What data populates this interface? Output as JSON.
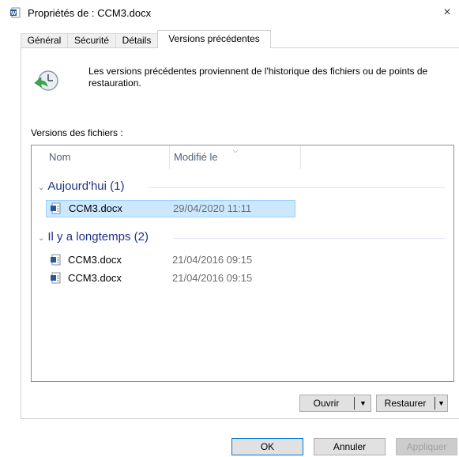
{
  "window": {
    "title": "Propriétés de : CCM3.docx",
    "close_glyph": "×"
  },
  "tabs": [
    {
      "label": "Général"
    },
    {
      "label": "Sécurité"
    },
    {
      "label": "Détails"
    },
    {
      "label": "Versions précédentes",
      "active": true
    }
  ],
  "info": {
    "icon": "restore-clock-icon",
    "text": "Les versions précédentes proviennent de l'historique des fichiers ou de points de restauration."
  },
  "versions_label": "Versions des fichiers :",
  "list": {
    "columns": [
      "Nom",
      "Modifié le"
    ],
    "groups": [
      {
        "label": "Aujourd'hui (1)",
        "rows": [
          {
            "name": "CCM3.docx",
            "modified": "29/04/2020 11:11",
            "selected": true
          }
        ]
      },
      {
        "label": "Il y a longtemps (2)",
        "rows": [
          {
            "name": "CCM3.docx",
            "modified": "21/04/2016 09:15"
          },
          {
            "name": "CCM3.docx",
            "modified": "21/04/2016 09:15"
          }
        ]
      }
    ]
  },
  "actions": {
    "open": "Ouvrir",
    "restore": "Restaurer"
  },
  "footer": {
    "ok": "OK",
    "cancel": "Annuler",
    "apply": "Appliquer"
  },
  "colors": {
    "selection_bg": "#cce8ff",
    "selection_border": "#99d1ff",
    "group_text": "#1e3287",
    "default_button_border": "#0078d7"
  }
}
